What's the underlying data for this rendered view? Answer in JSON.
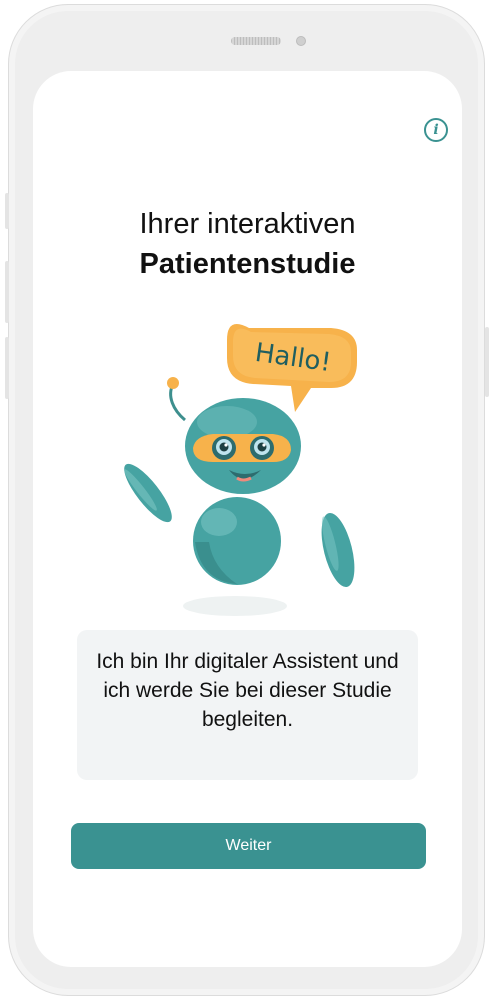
{
  "screen": {
    "title_line1": "Ihrer interaktiven",
    "title_line2": "Patientenstudie",
    "info_icon_glyph": "i",
    "speech_bubble": "Hallo!",
    "message": "Ich bin Ihr digitaler Assistent und ich werde Sie bei dieser Studie begleiten.",
    "button_label": "Weiter"
  },
  "colors": {
    "accent": "#3a9291",
    "robot_body": "#4aa6a5",
    "bubble": "#f7b24b"
  },
  "icons": {
    "info": "info-icon",
    "mascot": "robot-mascot-illustration"
  }
}
